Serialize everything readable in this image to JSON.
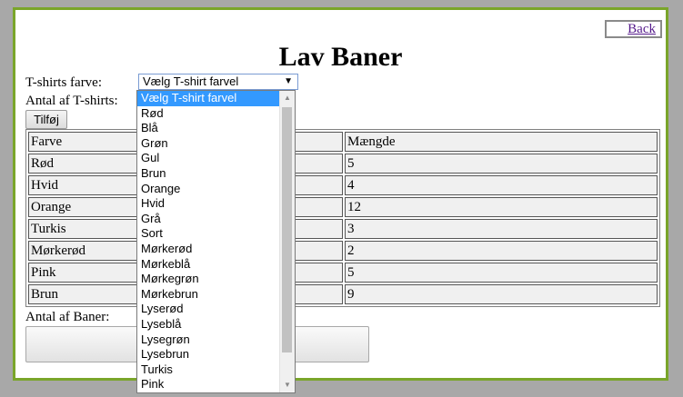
{
  "header": {
    "back_label": "Back",
    "title": "Lav Baner"
  },
  "form": {
    "color_label": "T-shirts farve:",
    "count_label": "Antal af T-shirts:",
    "selected_color": "Vælg T-shirt farvel",
    "add_label": "Tilføj",
    "baner_label": "Antal af Baner:"
  },
  "table": {
    "headers": [
      "Farve",
      "Mængde"
    ],
    "rows": [
      [
        "Rød",
        "5"
      ],
      [
        "Hvid",
        "4"
      ],
      [
        "Orange",
        "12"
      ],
      [
        "Turkis",
        "3"
      ],
      [
        "Mørkerød",
        "2"
      ],
      [
        "Pink",
        "5"
      ],
      [
        "Brun",
        "9"
      ]
    ]
  },
  "dropdown": {
    "options": [
      "Vælg T-shirt farvel",
      "Rød",
      "Blå",
      "Grøn",
      "Gul",
      "Brun",
      "Orange",
      "Hvid",
      "Grå",
      "Sort",
      "Mørkerød",
      "Mørkeblå",
      "Mørkegrøn",
      "Mørkebrun",
      "Lyserød",
      "Lyseblå",
      "Lysegrøn",
      "Lysebrun",
      "Turkis",
      "Pink"
    ],
    "highlighted": "Vælg T-shirt farvel"
  },
  "colors": {
    "frame_border": "#7aa52a",
    "page_bg": "#a8a8a8",
    "highlight": "#3399ff",
    "link": "#551a8b"
  }
}
